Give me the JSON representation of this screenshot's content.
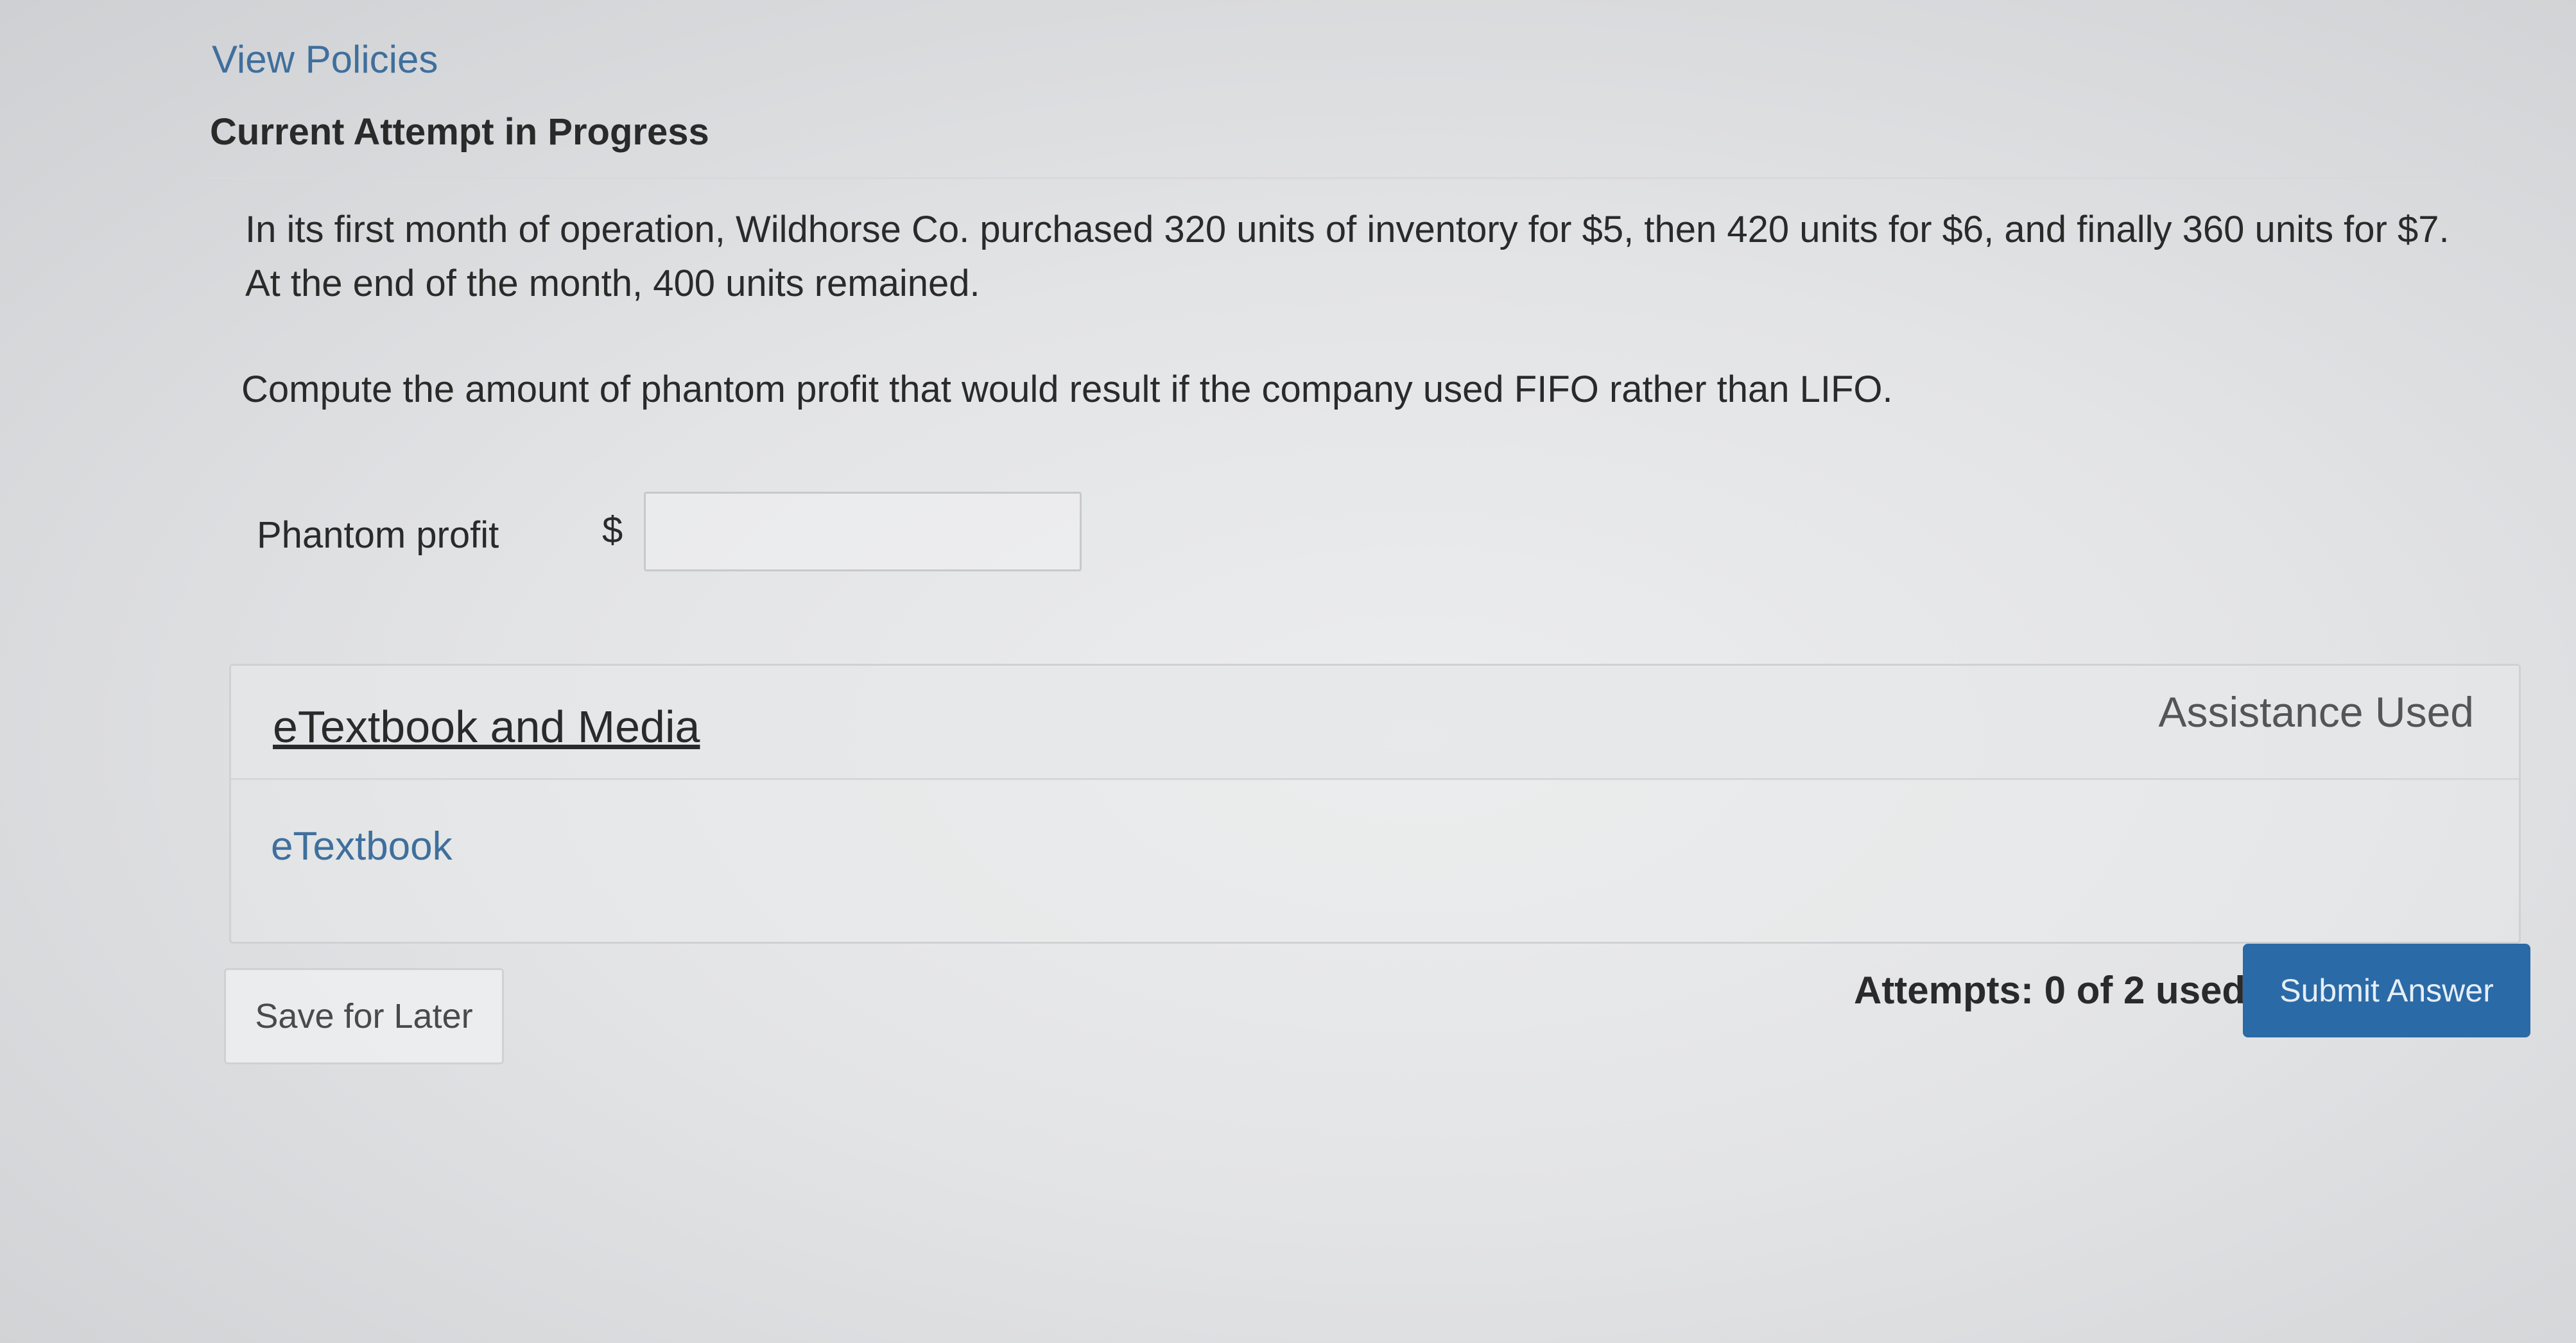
{
  "header": {
    "view_policies": "View Policies",
    "attempt_heading": "Current Attempt in Progress"
  },
  "question": {
    "text": "In its first month of operation, Wildhorse Co. purchased 320 units of inventory for $5, then 420 units for $6, and finally 360 units for $7. At the end of the month, 400 units remained.",
    "instruction": "Compute the amount of phantom profit that would result if the company used FIFO rather than LIFO."
  },
  "answer": {
    "label": "Phantom profit",
    "currency": "$",
    "value": ""
  },
  "assistance": {
    "header_link": "eTextbook and Media",
    "status": "Assistance Used",
    "items": [
      "eTextbook"
    ]
  },
  "footer": {
    "save_label": "Save for Later",
    "attempts_text": "Attempts: 0 of 2 used",
    "submit_label": "Submit Answer"
  },
  "colors": {
    "link": "#3f6f9c",
    "submit_bg": "#2a6aa7"
  }
}
